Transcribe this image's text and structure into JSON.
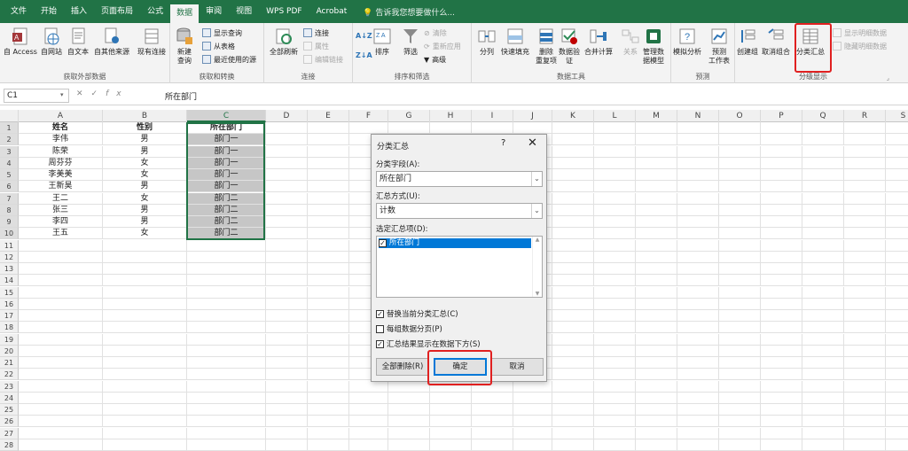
{
  "menu": {
    "tabs": [
      "文件",
      "开始",
      "插入",
      "页面布局",
      "公式",
      "数据",
      "审阅",
      "视图",
      "WPS PDF",
      "Acrobat"
    ],
    "active_tab": "数据",
    "tell_me": "告诉我您想要做什么..."
  },
  "ribbon": {
    "groups": {
      "external": "获取外部数据",
      "transform": "获取和转换",
      "connections": "连接",
      "sortfilter": "排序和筛选",
      "datatools": "数据工具",
      "forecast": "预测",
      "outline": "分级显示"
    },
    "external": {
      "access": "自 Access",
      "web": "自网站",
      "text": "自文本",
      "other": "自其他来源",
      "existing": "现有连接"
    },
    "transform": {
      "newquery1": "新建",
      "newquery2": "查询",
      "show_query": "显示查询",
      "from_table": "从表格",
      "recent": "最近使用的源"
    },
    "connections": {
      "refresh": "全部刷新",
      "conn": "连接",
      "props": "属性",
      "edit_links": "编辑链接"
    },
    "sortfilter": {
      "sort": "排序",
      "filter": "筛选",
      "clear": "清除",
      "reapply": "重新应用",
      "advanced": "高级"
    },
    "datatools": {
      "split": "分列",
      "flash": "快速填充",
      "dedup1": "删除",
      "dedup2": "重复项",
      "valid1": "数据验",
      "valid2": "证",
      "consolidate": "合并计算",
      "relations": "关系",
      "model1": "管理数",
      "model2": "据模型"
    },
    "forecast": {
      "whatif": "模拟分析",
      "sheet1": "预测",
      "sheet2": "工作表"
    },
    "outline": {
      "group": "创建组",
      "ungroup": "取消组合",
      "subtotal": "分类汇总",
      "show_detail": "显示明细数据",
      "hide_detail": "隐藏明细数据"
    }
  },
  "formula_bar": {
    "name_box": "C1",
    "content": "所在部门"
  },
  "columns": [
    "A",
    "B",
    "C",
    "D",
    "E",
    "F",
    "G",
    "H",
    "I",
    "J",
    "K",
    "L",
    "M",
    "N",
    "O",
    "P",
    "Q",
    "R",
    "S"
  ],
  "rows": [
    "1",
    "2",
    "3",
    "4",
    "5",
    "6",
    "7",
    "8",
    "9",
    "10",
    "11",
    "12",
    "13",
    "14",
    "15",
    "16",
    "17",
    "18",
    "19",
    "20",
    "21",
    "22",
    "23",
    "24",
    "25",
    "26",
    "27",
    "28"
  ],
  "sheet": {
    "headers": [
      "姓名",
      "性别",
      "所在部门"
    ],
    "data": [
      [
        "李伟",
        "男",
        "部门一"
      ],
      [
        "陈荣",
        "男",
        "部门一"
      ],
      [
        "周芬芬",
        "女",
        "部门一"
      ],
      [
        "李美美",
        "女",
        "部门一"
      ],
      [
        "王新昊",
        "男",
        "部门一"
      ],
      [
        "王二",
        "女",
        "部门二"
      ],
      [
        "张三",
        "男",
        "部门二"
      ],
      [
        "李四",
        "男",
        "部门二"
      ],
      [
        "王五",
        "女",
        "部门二"
      ]
    ]
  },
  "dialog": {
    "title": "分类汇总",
    "help": "?",
    "close": "✕",
    "field_label": "分类字段(A):",
    "field_value": "所在部门",
    "method_label": "汇总方式(U):",
    "method_value": "计数",
    "items_label": "选定汇总项(D):",
    "items": [
      "所在部门"
    ],
    "opt_replace": "替换当前分类汇总(C)",
    "opt_pagebreak": "每组数据分页(P)",
    "opt_below": "汇总结果显示在数据下方(S)",
    "btn_remove": "全部删除(R)",
    "btn_ok": "确定",
    "btn_cancel": "取消"
  }
}
